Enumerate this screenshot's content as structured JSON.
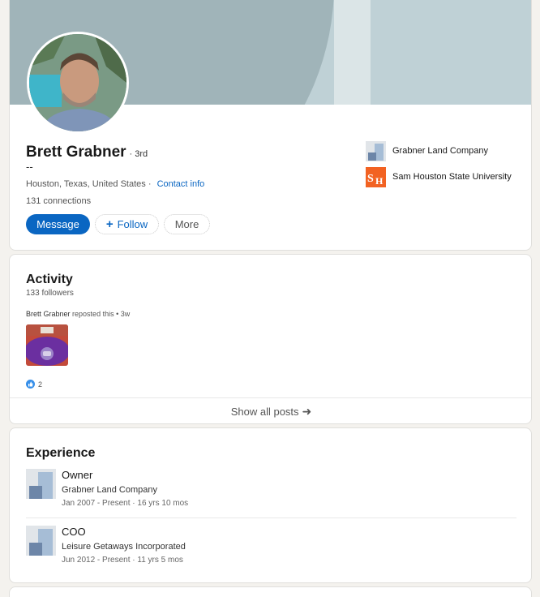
{
  "profile": {
    "name": "Brett Grabner",
    "degree": "· 3rd",
    "headline": "--",
    "location": "Houston, Texas, United States ·",
    "contact_info": "Contact info",
    "connections": "131 connections",
    "buttons": {
      "message": "Message",
      "follow": "Follow",
      "more": "More"
    },
    "organizations": [
      {
        "name": "Grabner Land Company",
        "logo": "building-logo-icon"
      },
      {
        "name": "Sam Houston State University",
        "logo": "shsu-logo-icon"
      }
    ]
  },
  "activity": {
    "title": "Activity",
    "followers": "133 followers",
    "repost_author": "Brett Grabner",
    "repost_text": "reposted this • 3w",
    "reaction_count": "2",
    "show_all": "Show all posts"
  },
  "experience": {
    "title": "Experience",
    "items": [
      {
        "title": "Owner",
        "company": "Grabner Land Company",
        "dates": "Jan 2007 - Present · 16 yrs 10 mos"
      },
      {
        "title": "COO",
        "company": "Leisure Getaways Incorporated",
        "dates": "Jun 2012 - Present · 11 yrs 5 mos"
      }
    ]
  },
  "colors": {
    "accent": "#0a66c2",
    "banner": "#bfd1d6",
    "shsu_orange": "#f26222"
  }
}
